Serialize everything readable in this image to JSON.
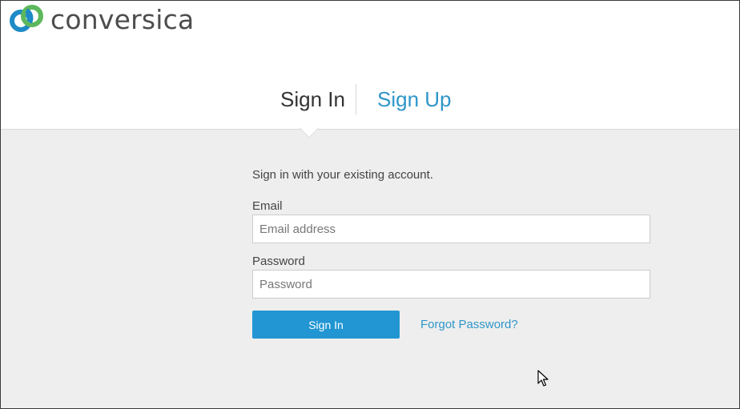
{
  "brand": {
    "name": "conversica",
    "colors": {
      "ring_blue": "#1e8ac6",
      "ring_green": "#5cb85c",
      "text": "#4d4d4d"
    }
  },
  "tabs": [
    {
      "label": "Sign In",
      "active": true
    },
    {
      "label": "Sign Up",
      "active": false
    }
  ],
  "form": {
    "intro": "Sign in with your existing account.",
    "email_label": "Email",
    "email_placeholder": "Email address",
    "email_value": "",
    "password_label": "Password",
    "password_placeholder": "Password",
    "password_value": "",
    "submit_label": "Sign In",
    "forgot_label": "Forgot Password?"
  },
  "colors": {
    "accent": "#2196d3",
    "link": "#2f96c9",
    "content_bg": "#eeeeee"
  },
  "icons": {
    "logo": "conversica-rings-icon",
    "cursor": "mouse-pointer-icon"
  }
}
